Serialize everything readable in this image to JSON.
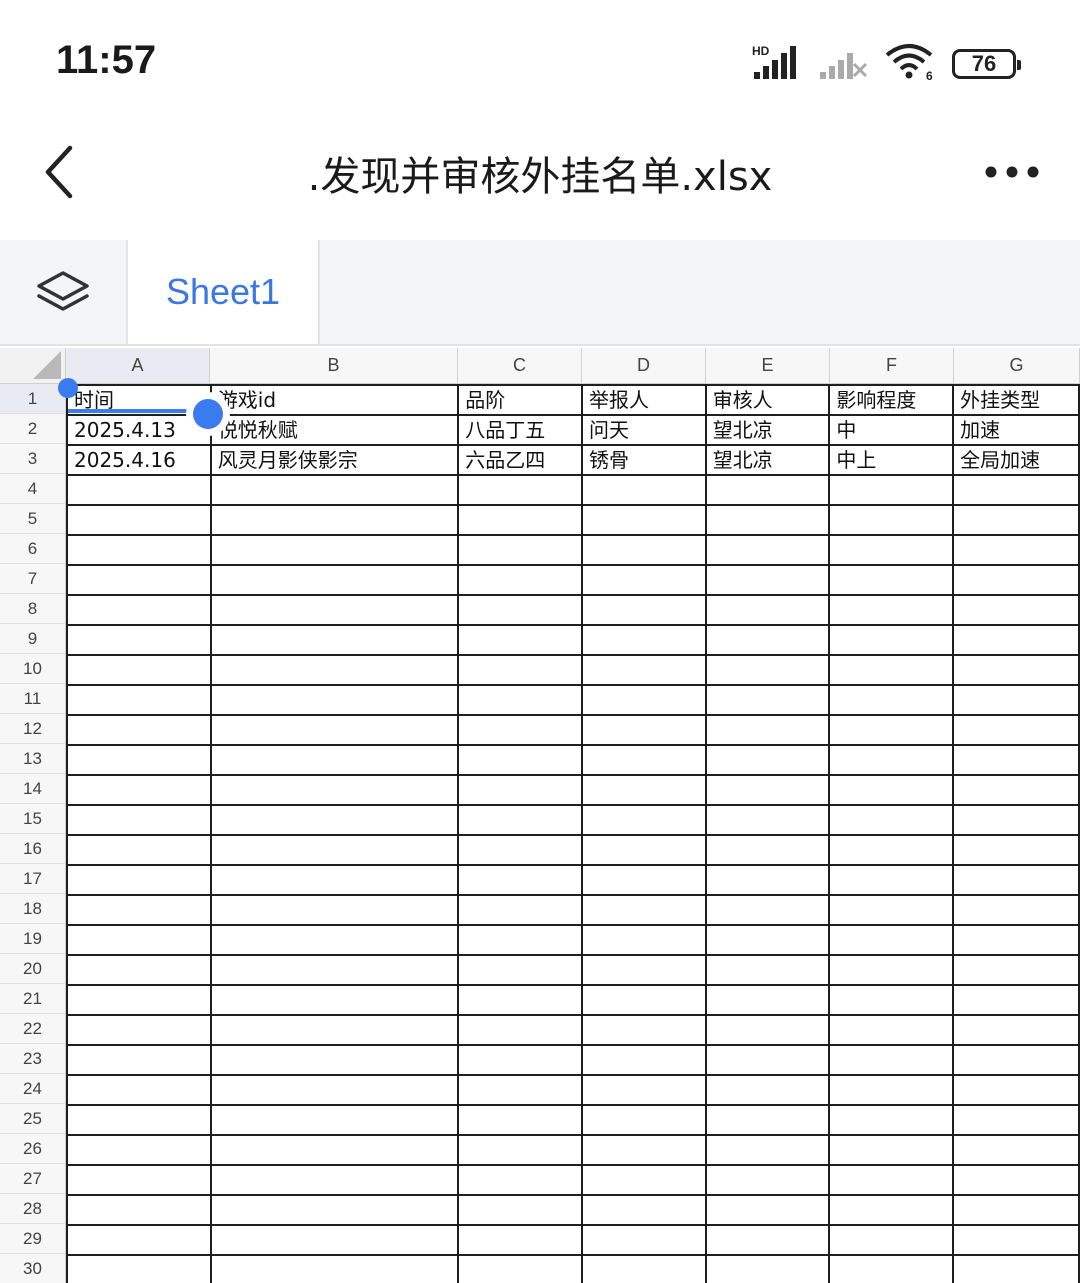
{
  "status_bar": {
    "time": "11:57",
    "network_label": "HD",
    "wifi_label": "6",
    "battery": "76",
    "icons": [
      "hd-signal-icon",
      "signal-off-icon",
      "wifi-icon",
      "battery-icon"
    ]
  },
  "title_bar": {
    "title": ".发现并审核外挂名单.xlsx",
    "back_icon": "chevron-left-icon",
    "more_icon": "more-horizontal-icon"
  },
  "sheet_bar": {
    "layers_icon": "layers-icon",
    "tabs": [
      {
        "label": "Sheet1",
        "active": true
      }
    ]
  },
  "grid": {
    "columns": [
      "A",
      "B",
      "C",
      "D",
      "E",
      "F",
      "G"
    ],
    "row_numbers": [
      "1",
      "2",
      "3",
      "4",
      "5",
      "6",
      "7",
      "8",
      "9",
      "10",
      "11",
      "12",
      "13",
      "14",
      "15",
      "16",
      "17",
      "18",
      "19",
      "20",
      "21",
      "22",
      "23",
      "24",
      "25",
      "26",
      "27",
      "28",
      "29",
      "30"
    ],
    "rows": [
      [
        "时间",
        "游戏id",
        "品阶",
        "举报人",
        "审核人",
        "影响程度",
        "外挂类型"
      ],
      [
        "2025.4.13",
        "悦悦秋赋",
        "八品丁五",
        "问天",
        "望北凉",
        "中",
        "加速"
      ],
      [
        "2025.4.16",
        "风灵月影侠影宗",
        "六品乙四",
        "锈骨",
        "望北凉",
        "中上",
        "全局加速"
      ]
    ],
    "selected_cell": "A1",
    "accent_color": "#3b7bf0"
  }
}
